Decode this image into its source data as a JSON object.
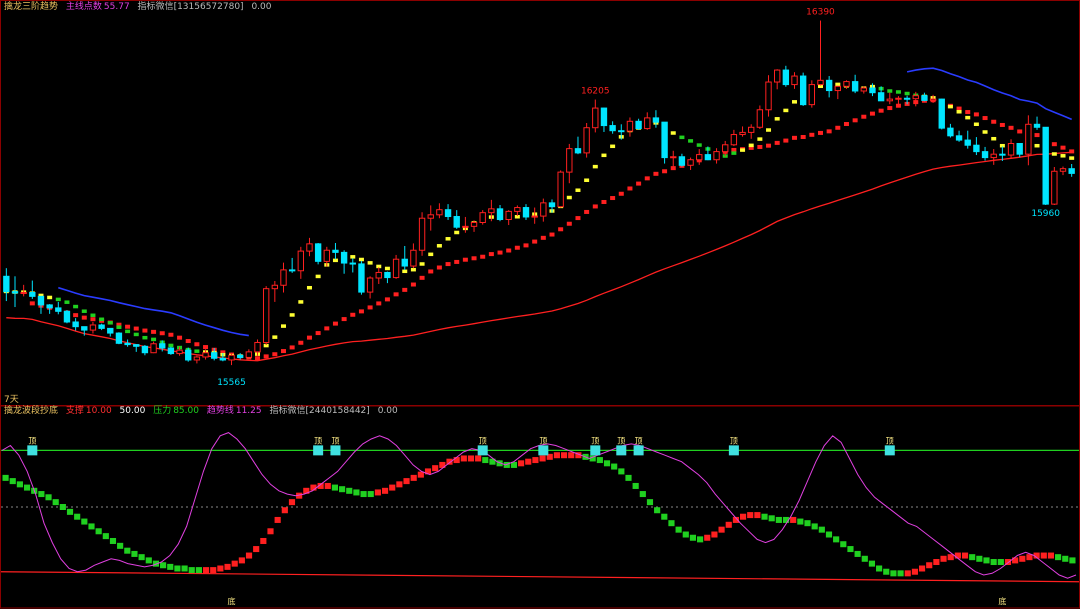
{
  "colors": {
    "background": "#000000",
    "frame": "#8b0000",
    "up": "#ff2020",
    "down": "#00e5ff",
    "yellow_line": "#ffff33",
    "red_ma": "#ff2020",
    "blue_line": "#2a3cff",
    "green_dots": "#20d020",
    "magenta": "#e040e0",
    "top_line": "#20d020",
    "bottom_line": "#ff2020",
    "mid_line": "#888888"
  },
  "top_panel": {
    "title": "擒龙三阶趋势",
    "badge_label": "主线点数",
    "badge_value": "55.77",
    "contact_label": "指标微信",
    "contact_value": "[13156572780]",
    "trailing_value": "0.00",
    "period_label": "7天"
  },
  "bottom_panel": {
    "title": "擒龙波段抄底",
    "support_label": "支撑",
    "support_value": "10.00",
    "mid_value": "50.00",
    "pressure_label": "压力",
    "pressure_value": "85.00",
    "trend_label": "趋势线",
    "trend_value": "11.25",
    "contact_label": "指标微信",
    "contact_value": "[2440158442]",
    "trailing_value": "0.00",
    "top_marker": "顶",
    "bottom_marker": "底"
  },
  "chart_data": {
    "type": "candlestick",
    "price_annotations": [
      {
        "label": "15565",
        "value": 15565,
        "kind": "low"
      },
      {
        "label": "16205",
        "value": 16205,
        "kind": "high"
      },
      {
        "label": "16390",
        "value": 16390,
        "kind": "high"
      },
      {
        "label": "15960",
        "value": 15960,
        "kind": "low"
      }
    ],
    "bars": 124,
    "candles": [
      [
        15791,
        15810,
        15733,
        15755
      ],
      [
        15755,
        15791,
        15719,
        15752
      ],
      [
        15752,
        15771,
        15744,
        15753
      ],
      [
        15753,
        15781,
        15738,
        15744
      ],
      [
        15744,
        15744,
        15703,
        15724
      ],
      [
        15724,
        15726,
        15703,
        15717
      ],
      [
        15717,
        15731,
        15702,
        15709
      ],
      [
        15709,
        15712,
        15681,
        15684
      ],
      [
        15684,
        15693,
        15664,
        15673
      ],
      [
        15673,
        15673,
        15652,
        15665
      ],
      [
        15665,
        15684,
        15657,
        15677
      ],
      [
        15677,
        15680,
        15665,
        15669
      ],
      [
        15669,
        15669,
        15650,
        15658
      ],
      [
        15658,
        15660,
        15632,
        15634
      ],
      [
        15634,
        15643,
        15626,
        15631
      ],
      [
        15631,
        15631,
        15614,
        15627
      ],
      [
        15627,
        15630,
        15606,
        15612
      ],
      [
        15612,
        15638,
        15611,
        15633
      ],
      [
        15633,
        15641,
        15615,
        15623
      ],
      [
        15623,
        15626,
        15607,
        15610
      ],
      [
        15610,
        15626,
        15605,
        15618
      ],
      [
        15618,
        15624,
        15591,
        15595
      ],
      [
        15595,
        15605,
        15587,
        15602
      ],
      [
        15602,
        15620,
        15596,
        15612
      ],
      [
        15612,
        15623,
        15594,
        15599
      ],
      [
        15599,
        15611,
        15592,
        15595
      ],
      [
        15595,
        15611,
        15583,
        15606
      ],
      [
        15606,
        15611,
        15596,
        15601
      ],
      [
        15601,
        15620,
        15600,
        15614
      ],
      [
        15614,
        15643,
        15605,
        15636
      ],
      [
        15636,
        15768,
        15630,
        15762
      ],
      [
        15762,
        15780,
        15731,
        15770
      ],
      [
        15770,
        15823,
        15753,
        15806
      ],
      [
        15806,
        15834,
        15799,
        15804
      ],
      [
        15804,
        15860,
        15785,
        15850
      ],
      [
        15850,
        15881,
        15838,
        15867
      ],
      [
        15867,
        15869,
        15819,
        15826
      ],
      [
        15826,
        15860,
        15814,
        15852
      ],
      [
        15852,
        15869,
        15831,
        15847
      ],
      [
        15847,
        15852,
        15797,
        15822
      ],
      [
        15822,
        15833,
        15800,
        15820
      ],
      [
        15820,
        15827,
        15748,
        15754
      ],
      [
        15754,
        15791,
        15739,
        15787
      ],
      [
        15787,
        15812,
        15773,
        15800
      ],
      [
        15800,
        15802,
        15775,
        15788
      ],
      [
        15788,
        15841,
        15785,
        15831
      ],
      [
        15831,
        15862,
        15806,
        15815
      ],
      [
        15815,
        15868,
        15810,
        15852
      ],
      [
        15852,
        15941,
        15839,
        15927
      ],
      [
        15927,
        15957,
        15898,
        15935
      ],
      [
        15935,
        15962,
        15927,
        15947
      ],
      [
        15947,
        15960,
        15923,
        15931
      ],
      [
        15931,
        15946,
        15902,
        15906
      ],
      [
        15906,
        15930,
        15893,
        15908
      ],
      [
        15908,
        15922,
        15895,
        15917
      ],
      [
        15917,
        15946,
        15912,
        15940
      ],
      [
        15940,
        15970,
        15920,
        15949
      ],
      [
        15949,
        15958,
        15920,
        15924
      ],
      [
        15924,
        15946,
        15911,
        15943
      ],
      [
        15943,
        15957,
        15932,
        15952
      ],
      [
        15952,
        15960,
        15923,
        15930
      ],
      [
        15930,
        15952,
        15914,
        15932
      ],
      [
        15932,
        15973,
        15919,
        15963
      ],
      [
        15963,
        15971,
        15940,
        15954
      ],
      [
        15954,
        16039,
        15952,
        16035
      ],
      [
        16035,
        16101,
        16009,
        16090
      ],
      [
        16090,
        16118,
        16077,
        16080
      ],
      [
        16080,
        16150,
        16069,
        16139
      ],
      [
        16139,
        16205,
        16128,
        16185
      ],
      [
        16185,
        16186,
        16129,
        16144
      ],
      [
        16144,
        16154,
        16125,
        16132
      ],
      [
        16132,
        16147,
        16111,
        16131
      ],
      [
        16131,
        16163,
        16118,
        16154
      ],
      [
        16154,
        16160,
        16134,
        16137
      ],
      [
        16137,
        16175,
        16134,
        16162
      ],
      [
        16162,
        16180,
        16139,
        16152
      ],
      [
        16152,
        16152,
        16055,
        16069
      ],
      [
        16069,
        16085,
        16047,
        16071
      ],
      [
        16071,
        16078,
        16048,
        16051
      ],
      [
        16051,
        16069,
        16040,
        16064
      ],
      [
        16064,
        16089,
        16052,
        16076
      ],
      [
        16076,
        16095,
        16063,
        16064
      ],
      [
        16064,
        16091,
        16055,
        16083
      ],
      [
        16083,
        16108,
        16072,
        16099
      ],
      [
        16099,
        16134,
        16096,
        16123
      ],
      [
        16123,
        16142,
        16118,
        16128
      ],
      [
        16128,
        16147,
        16113,
        16140
      ],
      [
        16140,
        16191,
        16136,
        16181
      ],
      [
        16181,
        16262,
        16165,
        16246
      ],
      [
        16246,
        16276,
        16229,
        16274
      ],
      [
        16274,
        16284,
        16235,
        16240
      ],
      [
        16240,
        16269,
        16230,
        16260
      ],
      [
        16260,
        16268,
        16190,
        16193
      ],
      [
        16193,
        16250,
        16186,
        16240
      ],
      [
        16240,
        16390,
        16238,
        16250
      ],
      [
        16250,
        16260,
        16210,
        16226
      ],
      [
        16226,
        16237,
        16206,
        16236
      ],
      [
        16236,
        16250,
        16230,
        16247
      ],
      [
        16247,
        16263,
        16220,
        16225
      ],
      [
        16225,
        16236,
        16219,
        16232
      ],
      [
        16232,
        16243,
        16213,
        16221
      ],
      [
        16221,
        16236,
        16202,
        16202
      ],
      [
        16202,
        16221,
        16194,
        16206
      ],
      [
        16206,
        16213,
        16192,
        16208
      ],
      [
        16208,
        16214,
        16194,
        16207
      ],
      [
        16207,
        16223,
        16189,
        16214
      ],
      [
        16214,
        16221,
        16201,
        16203
      ],
      [
        16203,
        16216,
        16197,
        16206
      ],
      [
        16206,
        16207,
        16135,
        16138
      ],
      [
        16138,
        16148,
        16116,
        16120
      ],
      [
        16120,
        16132,
        16106,
        16110
      ],
      [
        16110,
        16132,
        16090,
        16098
      ],
      [
        16098,
        16117,
        16075,
        16083
      ],
      [
        16083,
        16094,
        16062,
        16069
      ],
      [
        16069,
        16089,
        16052,
        16077
      ],
      [
        16077,
        16095,
        16061,
        16075
      ],
      [
        16075,
        16112,
        16067,
        16102
      ],
      [
        16102,
        16102,
        16070,
        16077
      ],
      [
        16077,
        16168,
        16051,
        16147
      ],
      [
        16147,
        16165,
        16134,
        16140
      ],
      [
        16140,
        16140,
        15958,
        15960
      ],
      [
        15960,
        16047,
        15958,
        16037
      ],
      [
        16037,
        16048,
        16028,
        16043
      ],
      [
        16043,
        16054,
        16024,
        16032
      ]
    ],
    "ylim_top": [
      15520,
      16410
    ],
    "oscillator": {
      "ylim": [
        -5,
        105
      ],
      "support": 10,
      "mid": 50,
      "pressure": 85,
      "trend_steps": [
        68,
        66,
        64,
        62,
        60,
        58,
        56,
        53,
        50,
        47,
        44,
        41,
        38,
        35,
        32,
        29,
        26,
        23,
        21,
        19,
        17,
        15,
        14,
        13,
        12,
        12,
        11,
        11,
        11,
        11,
        12,
        13,
        15,
        17,
        20,
        24,
        29,
        35,
        42,
        48,
        53,
        57,
        60,
        62,
        63,
        63,
        62,
        61,
        60,
        59,
        58,
        58,
        59,
        60,
        62,
        64,
        66,
        68,
        70,
        72,
        74,
        76,
        78,
        79,
        80,
        80,
        80,
        79,
        78,
        77,
        76,
        76,
        77,
        78,
        79,
        80,
        81,
        82,
        82,
        82,
        82,
        81,
        80,
        79,
        77,
        75,
        72,
        68,
        63,
        58,
        53,
        48,
        44,
        40,
        36,
        33,
        31,
        30,
        31,
        33,
        36,
        39,
        42,
        44,
        45,
        45,
        44,
        43,
        42,
        42,
        42,
        41,
        40,
        38,
        36,
        33,
        30,
        27,
        24,
        21,
        18,
        15,
        12,
        10,
        9,
        9,
        9,
        10,
        12,
        14,
        16,
        18,
        19,
        20,
        20,
        19,
        18,
        17,
        16,
        16,
        16,
        17,
        18,
        19,
        20,
        20,
        20,
        19,
        18,
        17
      ],
      "magenta_line": [
        85,
        88,
        82,
        72,
        58,
        40,
        28,
        18,
        12,
        10,
        11,
        14,
        16,
        18,
        17,
        15,
        14,
        13,
        14,
        16,
        20,
        27,
        38,
        55,
        72,
        86,
        94,
        96,
        92,
        86,
        78,
        70,
        64,
        60,
        58,
        57,
        58,
        60,
        64,
        68,
        72,
        78,
        84,
        89,
        92,
        94,
        92,
        88,
        82,
        76,
        72,
        70,
        72,
        76,
        80,
        84,
        86,
        85,
        82,
        78,
        76,
        78,
        82,
        86,
        88,
        89,
        88,
        86,
        84,
        82,
        80,
        82,
        84,
        86,
        88,
        89,
        88,
        86,
        84,
        82,
        80,
        78,
        74,
        70,
        65,
        58,
        52,
        46,
        40,
        35,
        30,
        28,
        30,
        36,
        44,
        54,
        66,
        78,
        88,
        94,
        90,
        80,
        70,
        62,
        56,
        52,
        48,
        44,
        40,
        38,
        34,
        30,
        26,
        22,
        18,
        14,
        10,
        8,
        9,
        12,
        16,
        20,
        22,
        20,
        16,
        12,
        8,
        6,
        8
      ]
    },
    "top_markers_at_bar": [
      3,
      36,
      38,
      55,
      62,
      68,
      71,
      73,
      84,
      102
    ],
    "bottom_markers_at_bar": [
      26,
      115
    ]
  }
}
